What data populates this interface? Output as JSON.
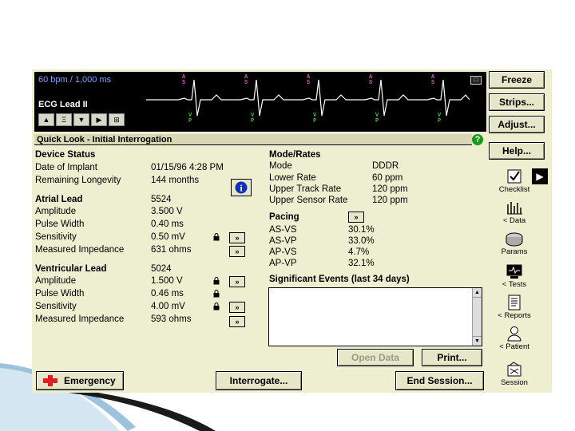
{
  "ecg": {
    "rate_text": "60 bpm / 1,000 ms",
    "lead_label": "ECG Lead II",
    "marker_top": "A S",
    "marker_bottom": "V P",
    "controls": [
      "up-arrow-icon",
      "filter-icon",
      "down-arrow-icon",
      "play-icon",
      "expand-icon"
    ]
  },
  "right_buttons": {
    "freeze": "Freeze",
    "strips": "Strips...",
    "adjust": "Adjust...",
    "help": "Help..."
  },
  "title": "Quick Look - Initial Interrogation",
  "device_status": {
    "heading": "Device Status",
    "date_label": "Date of Implant",
    "date_value": "01/15/96 4:28 PM",
    "longevity_label": "Remaining Longevity",
    "longevity_value": "144 months"
  },
  "atrial_lead": {
    "heading": "Atrial Lead",
    "model": "5524",
    "rows": [
      {
        "label": "Amplitude",
        "value": "3.500 V"
      },
      {
        "label": "Pulse Width",
        "value": "0.40 ms"
      },
      {
        "label": "Sensitivity",
        "value": "0.50 mV"
      },
      {
        "label": "Measured Impedance",
        "value": "631 ohms"
      }
    ]
  },
  "ventricular_lead": {
    "heading": "Ventricular Lead",
    "model": "5024",
    "rows": [
      {
        "label": "Amplitude",
        "value": "1.500 V"
      },
      {
        "label": "Pulse Width",
        "value": "0.46 ms"
      },
      {
        "label": "Sensitivity",
        "value": "4.00 mV"
      },
      {
        "label": "Measured Impedance",
        "value": "593 ohms"
      }
    ]
  },
  "mode_rates": {
    "heading": "Mode/Rates",
    "rows": [
      {
        "label": "Mode",
        "value": "DDDR"
      },
      {
        "label": "Lower Rate",
        "value": "60 ppm"
      },
      {
        "label": "Upper Track Rate",
        "value": "120 ppm"
      },
      {
        "label": "Upper Sensor Rate",
        "value": "120 ppm"
      }
    ]
  },
  "pacing": {
    "heading": "Pacing",
    "rows": [
      {
        "label": "AS-VS",
        "value": "30.1%"
      },
      {
        "label": "AS-VP",
        "value": "33.0%"
      },
      {
        "label": "AP-VS",
        "value": "4.7%"
      },
      {
        "label": "AP-VP",
        "value": "32.1%"
      }
    ]
  },
  "events": {
    "heading": "Significant Events (last 34 days)"
  },
  "arrow_glyph": "»",
  "buttons": {
    "open_data": "Open Data",
    "print": "Print...",
    "emergency": "Emergency",
    "interrogate": "Interrogate...",
    "end_session": "End Session..."
  },
  "sidebar": {
    "checklist": "Checklist",
    "data": "< Data",
    "params": "Params",
    "tests": "< Tests",
    "reports": "< Reports",
    "patient": "< Patient",
    "session": "Session"
  },
  "colors": {
    "panel": "#eeeed0",
    "ecg_bg": "#000000",
    "marker_magenta": "#d050d0",
    "marker_green": "#40c040",
    "emergency_red": "#e02020",
    "help_green": "#1a9a1a"
  }
}
